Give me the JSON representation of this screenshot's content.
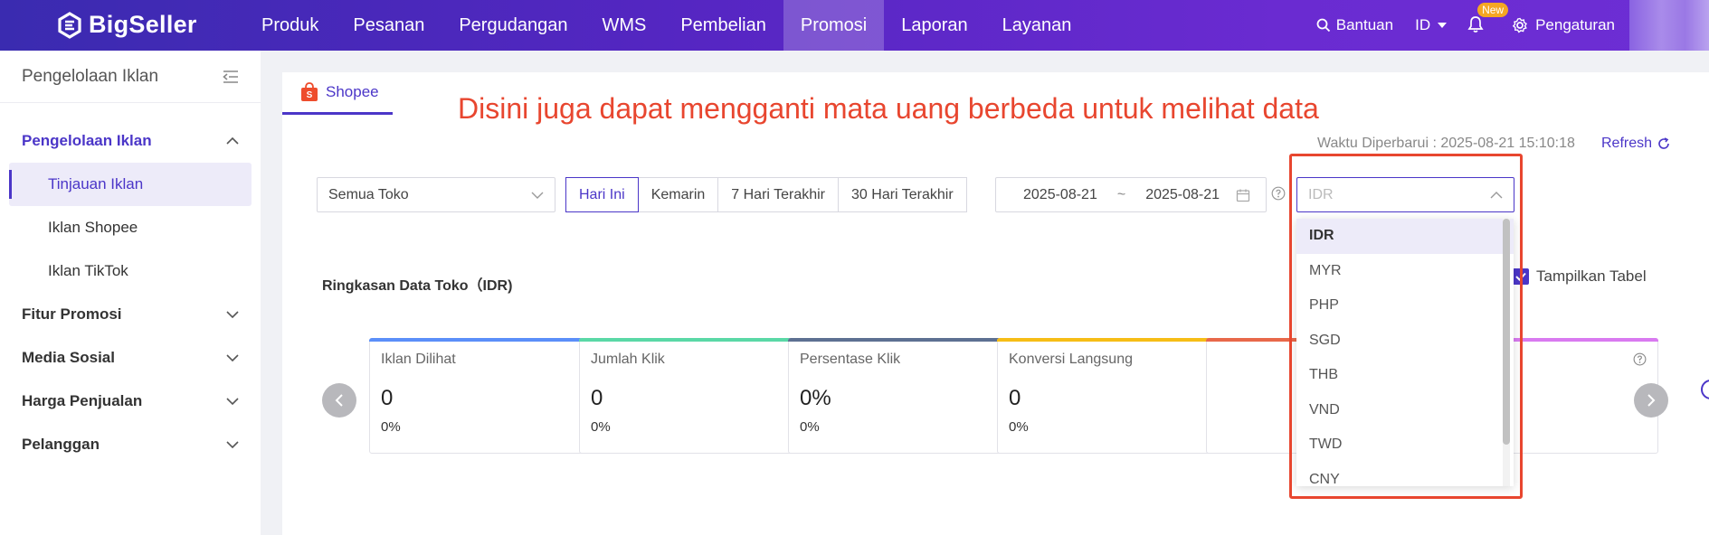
{
  "brand": {
    "name": "BigSeller",
    "accent": "#4b36c8",
    "annotation_color": "#e8462f"
  },
  "topnav": {
    "items": [
      "Produk",
      "Pesanan",
      "Pergudangan",
      "WMS",
      "Pembelian",
      "Promosi",
      "Laporan",
      "Layanan"
    ],
    "active": "Promosi",
    "help_label": "Bantuan",
    "language": "ID",
    "new_badge": "New",
    "settings_label": "Pengaturan"
  },
  "sidebar": {
    "title": "Pengelolaan Iklan",
    "open_group": "Pengelolaan Iklan",
    "sub_items": [
      "Tinjauan Iklan",
      "Iklan Shopee",
      "Iklan TikTok"
    ],
    "active_item": "Tinjauan Iklan",
    "groups": [
      "Fitur Promosi",
      "Media Sosial",
      "Harga Penjualan",
      "Pelanggan"
    ]
  },
  "main": {
    "tab_label": "Shopee",
    "annotation": "Disini juga dapat mengganti mata uang berbeda untuk melihat data",
    "updated_text": "Waktu Diperbarui : 2025-08-21 15:10:18",
    "refresh_label": "Refresh",
    "store_select": "Semua Toko",
    "periods": [
      "Hari Ini",
      "Kemarin",
      "7 Hari Terakhir",
      "30 Hari Terakhir"
    ],
    "active_period": "Hari Ini",
    "date_start": "2025-08-21",
    "date_sep": "~",
    "date_end": "2025-08-21",
    "currency_placeholder": "IDR",
    "summary_title": "Ringkasan Data Toko（IDR)",
    "show_table_label": "Tampilkan Tabel",
    "show_table_checked": true
  },
  "cards": [
    {
      "label": "Iklan Dilihat",
      "value": "0",
      "pct": "0%",
      "color": "#5b8ff9"
    },
    {
      "label": "Jumlah Klik",
      "value": "0",
      "pct": "0%",
      "color": "#5ad8a6"
    },
    {
      "label": "Persentase Klik",
      "value": "0%",
      "pct": "0%",
      "color": "#5d7092"
    },
    {
      "label": "Konversi Langsung",
      "value": "0",
      "pct": "0%",
      "color": "#f6bd16"
    },
    {
      "label": "",
      "value": "",
      "pct": "",
      "color": "#e8684a"
    },
    {
      "label": "",
      "value": "",
      "pct": "",
      "color": "#d97af0"
    }
  ],
  "currency_options": [
    "IDR",
    "MYR",
    "PHP",
    "SGD",
    "THB",
    "VND",
    "TWD",
    "CNY"
  ],
  "currency_selected": "IDR"
}
